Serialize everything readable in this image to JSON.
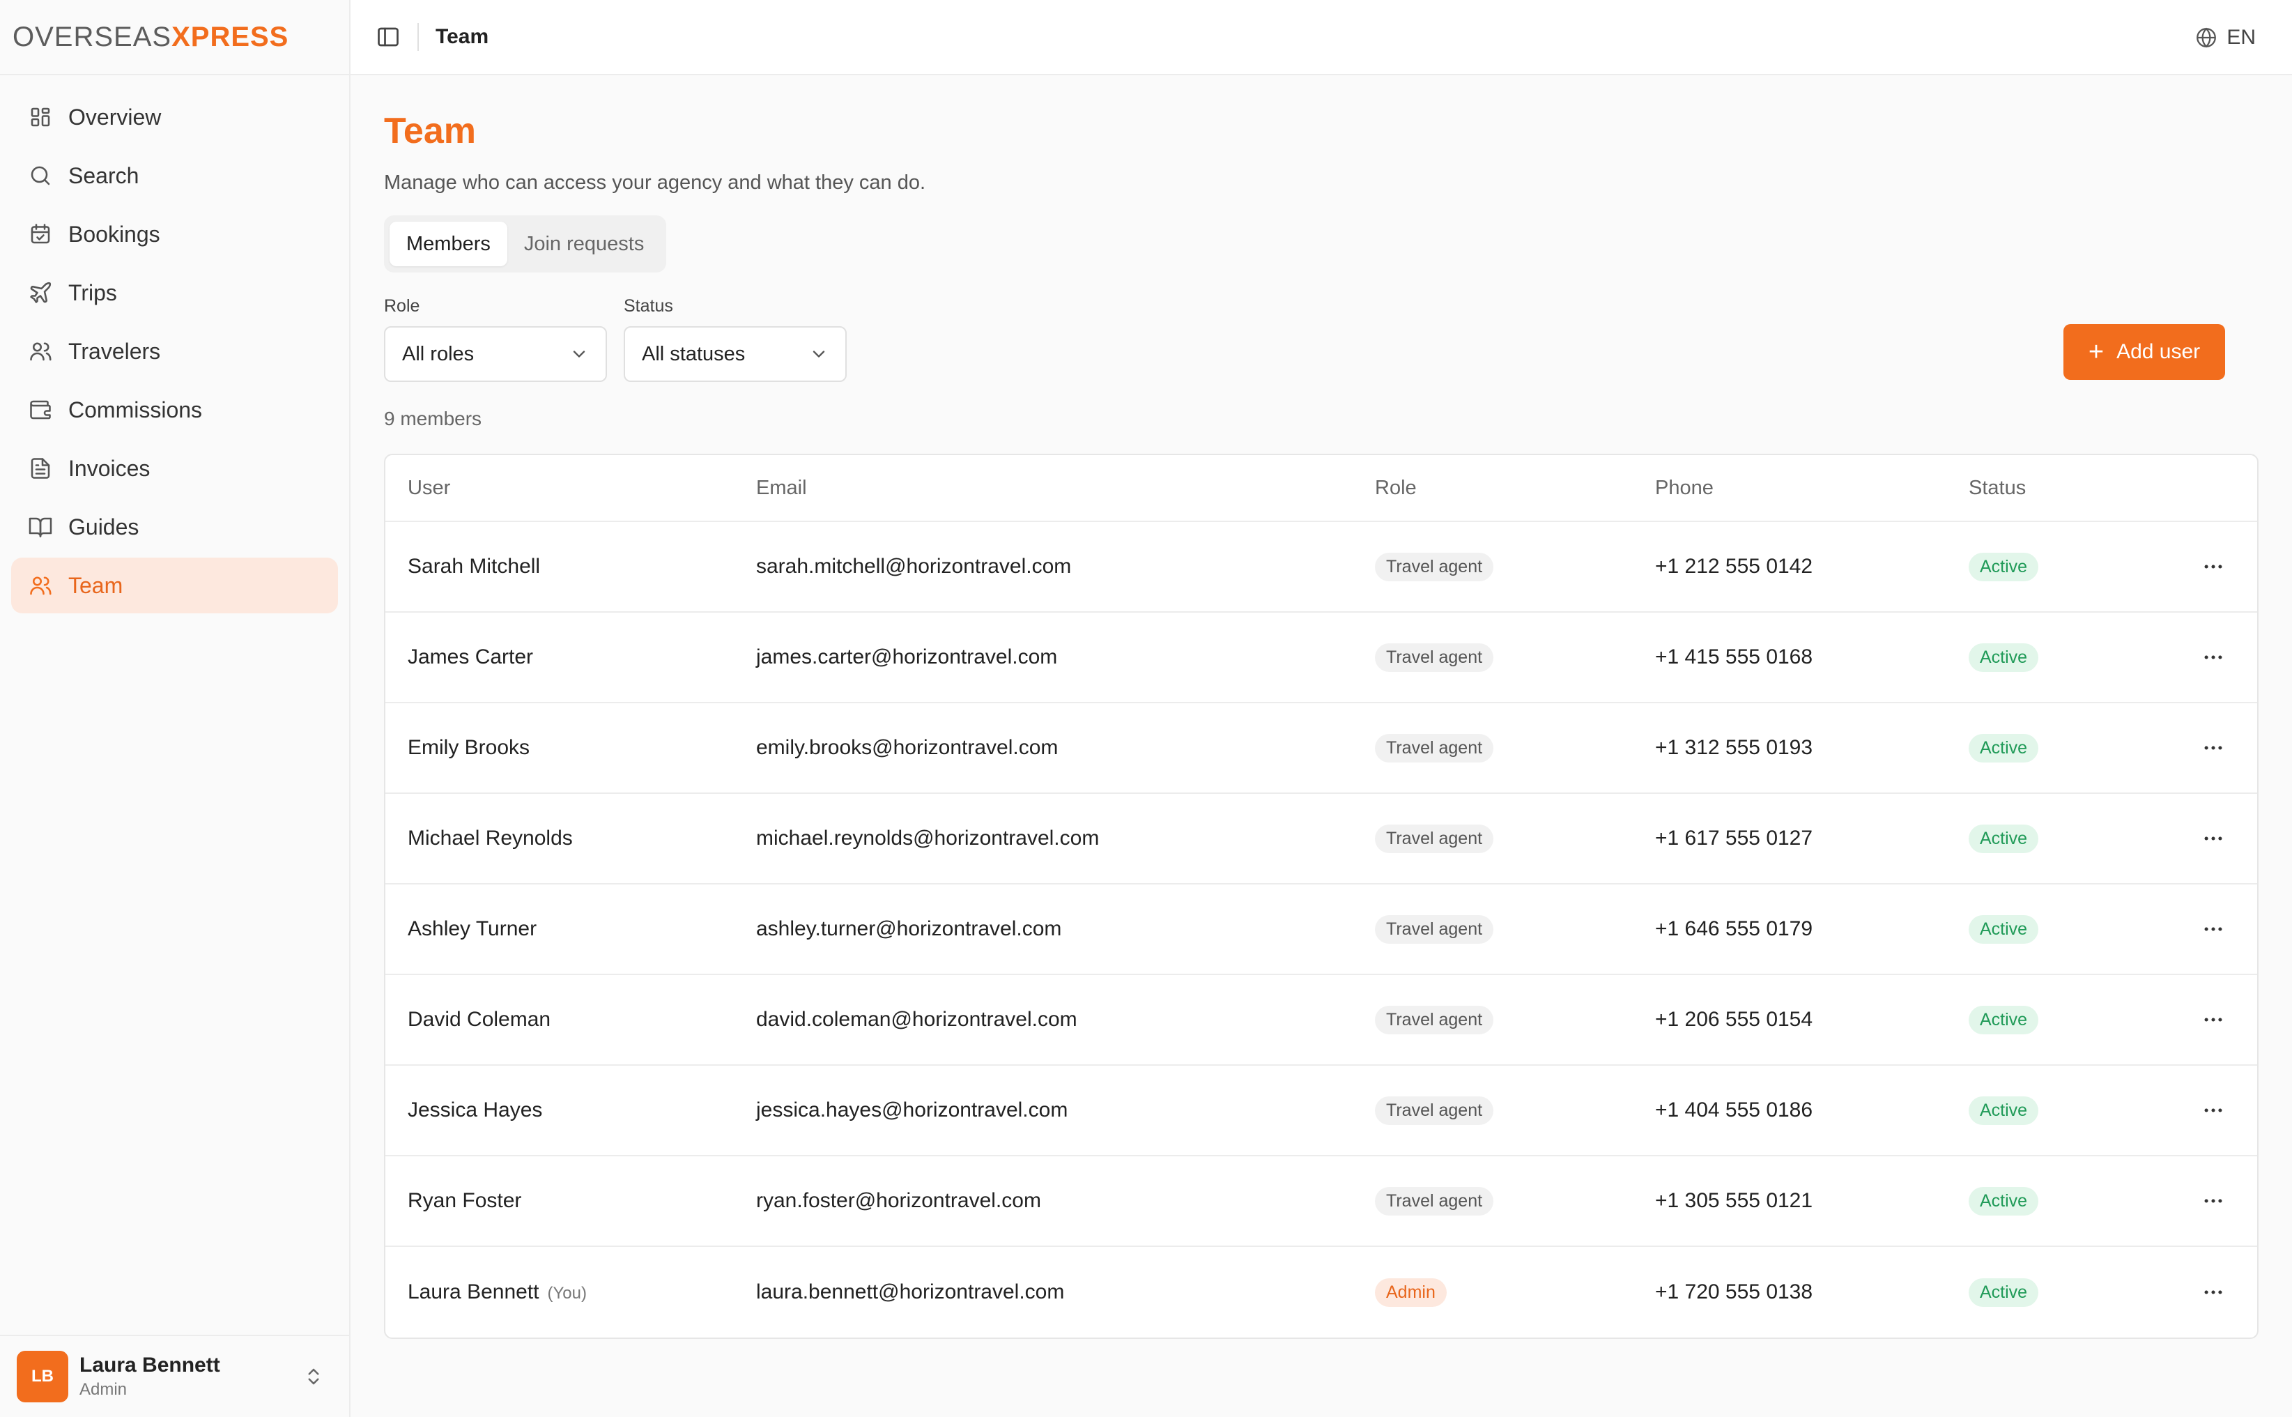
{
  "brand": {
    "logo_left": "OVERSEAS",
    "logo_accent": "XPRESS"
  },
  "sidebar": {
    "items": [
      {
        "label": "Overview",
        "icon": "grid-icon"
      },
      {
        "label": "Search",
        "icon": "search-icon"
      },
      {
        "label": "Bookings",
        "icon": "calendar-check-icon"
      },
      {
        "label": "Trips",
        "icon": "plane-icon"
      },
      {
        "label": "Travelers",
        "icon": "users-icon"
      },
      {
        "label": "Commissions",
        "icon": "wallet-icon"
      },
      {
        "label": "Invoices",
        "icon": "file-text-icon"
      },
      {
        "label": "Guides",
        "icon": "book-icon"
      },
      {
        "label": "Team",
        "icon": "team-icon",
        "active": true
      }
    ],
    "user": {
      "initials": "LB",
      "name": "Laura Bennett",
      "role": "Admin"
    }
  },
  "topbar": {
    "title": "Team",
    "language": "EN"
  },
  "page": {
    "title": "Team",
    "subtitle": "Manage who can access your agency and what they can do.",
    "tabs": [
      "Members",
      "Join requests"
    ],
    "active_tab": "Members",
    "filters": {
      "role_label": "Role",
      "role_value": "All roles",
      "status_label": "Status",
      "status_value": "All statuses"
    },
    "add_button": "Add user",
    "member_count": "9 members"
  },
  "table": {
    "headers": [
      "User",
      "Email",
      "Role",
      "Phone",
      "Status"
    ],
    "rows": [
      {
        "name": "Sarah Mitchell",
        "you": "",
        "email": "sarah.mitchell@horizontravel.com",
        "role": "Travel agent",
        "phone": "+1 212 555 0142",
        "status": "Active"
      },
      {
        "name": "James Carter",
        "you": "",
        "email": "james.carter@horizontravel.com",
        "role": "Travel agent",
        "phone": "+1 415 555 0168",
        "status": "Active"
      },
      {
        "name": "Emily Brooks",
        "you": "",
        "email": "emily.brooks@horizontravel.com",
        "role": "Travel agent",
        "phone": "+1 312 555 0193",
        "status": "Active"
      },
      {
        "name": "Michael Reynolds",
        "you": "",
        "email": "michael.reynolds@horizontravel.com",
        "role": "Travel agent",
        "phone": "+1 617 555 0127",
        "status": "Active"
      },
      {
        "name": "Ashley Turner",
        "you": "",
        "email": "ashley.turner@horizontravel.com",
        "role": "Travel agent",
        "phone": "+1 646 555 0179",
        "status": "Active"
      },
      {
        "name": "David Coleman",
        "you": "",
        "email": "david.coleman@horizontravel.com",
        "role": "Travel agent",
        "phone": "+1 206 555 0154",
        "status": "Active"
      },
      {
        "name": "Jessica Hayes",
        "you": "",
        "email": "jessica.hayes@horizontravel.com",
        "role": "Travel agent",
        "phone": "+1 404 555 0186",
        "status": "Active"
      },
      {
        "name": "Ryan Foster",
        "you": "",
        "email": "ryan.foster@horizontravel.com",
        "role": "Travel agent",
        "phone": "+1 305 555 0121",
        "status": "Active"
      },
      {
        "name": "Laura Bennett",
        "you": "(You)",
        "email": "laura.bennett@horizontravel.com",
        "role": "Admin",
        "phone": "+1 720 555 0138",
        "status": "Active"
      }
    ]
  },
  "colors": {
    "accent": "#f26d1d",
    "accent_soft": "#fde8de",
    "success": "#1f9a57",
    "success_soft": "#e2f6ea"
  }
}
